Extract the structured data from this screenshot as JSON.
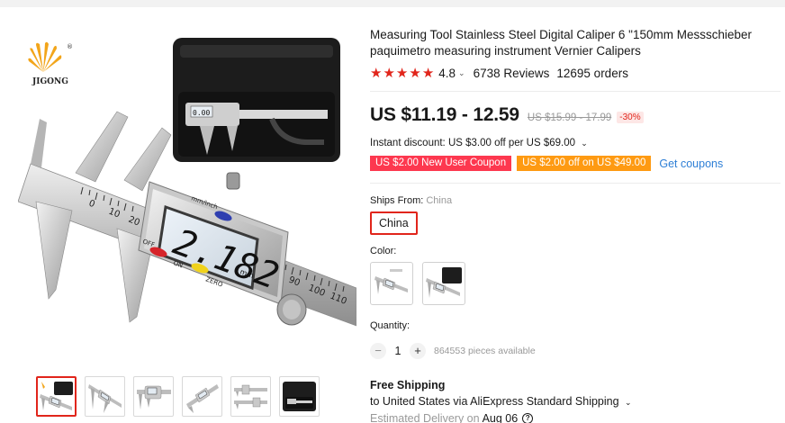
{
  "gallery": {
    "brand_logo_text": "JIGONG",
    "display_reading": "2.182",
    "display_unit": "mm",
    "display_top_label": "mm/inch",
    "button_off": "OFF",
    "button_on": "ON",
    "button_zero": "ZERO",
    "case_display": "0.00",
    "scale_left": [
      "0",
      "10",
      "20"
    ],
    "scale_right": [
      "90",
      "100",
      "110"
    ],
    "thumbnail_count": 6,
    "active_thumbnail": 0
  },
  "product": {
    "title": "Measuring Tool Stainless Steel Digital Caliper 6 \"150mm Messschieber paquimetro measuring instrument Vernier Calipers",
    "rating": "4.8",
    "stars": 5,
    "reviews": "6738 Reviews",
    "orders": "12695 orders"
  },
  "price": {
    "current": "US $11.19 - 12.59",
    "original": "US $15.99 - 17.99",
    "discount": "-30%",
    "instant_discount": "Instant discount: US $3.00 off per US $69.00"
  },
  "coupons": {
    "new_user": "US $2.00 New User Coupon",
    "threshold": "US $2.00 off on US $49.00",
    "get_coupons": "Get coupons"
  },
  "shipping_from": {
    "label": "Ships From:",
    "selected": "China",
    "option": "China"
  },
  "color": {
    "label": "Color:"
  },
  "quantity": {
    "label": "Quantity:",
    "minus": "−",
    "value": "1",
    "plus": "+",
    "available": "864553 pieces available"
  },
  "delivery": {
    "free_shipping": "Free Shipping",
    "via": "to United States via AliExpress Standard Shipping",
    "estimated_label": "Estimated Delivery on",
    "estimated_date": "Aug 06"
  },
  "colors": {
    "accent": "#e1251b",
    "coupon_red": "#fd384f",
    "coupon_orange": "#fe9a12",
    "link": "#2e7fd6"
  }
}
